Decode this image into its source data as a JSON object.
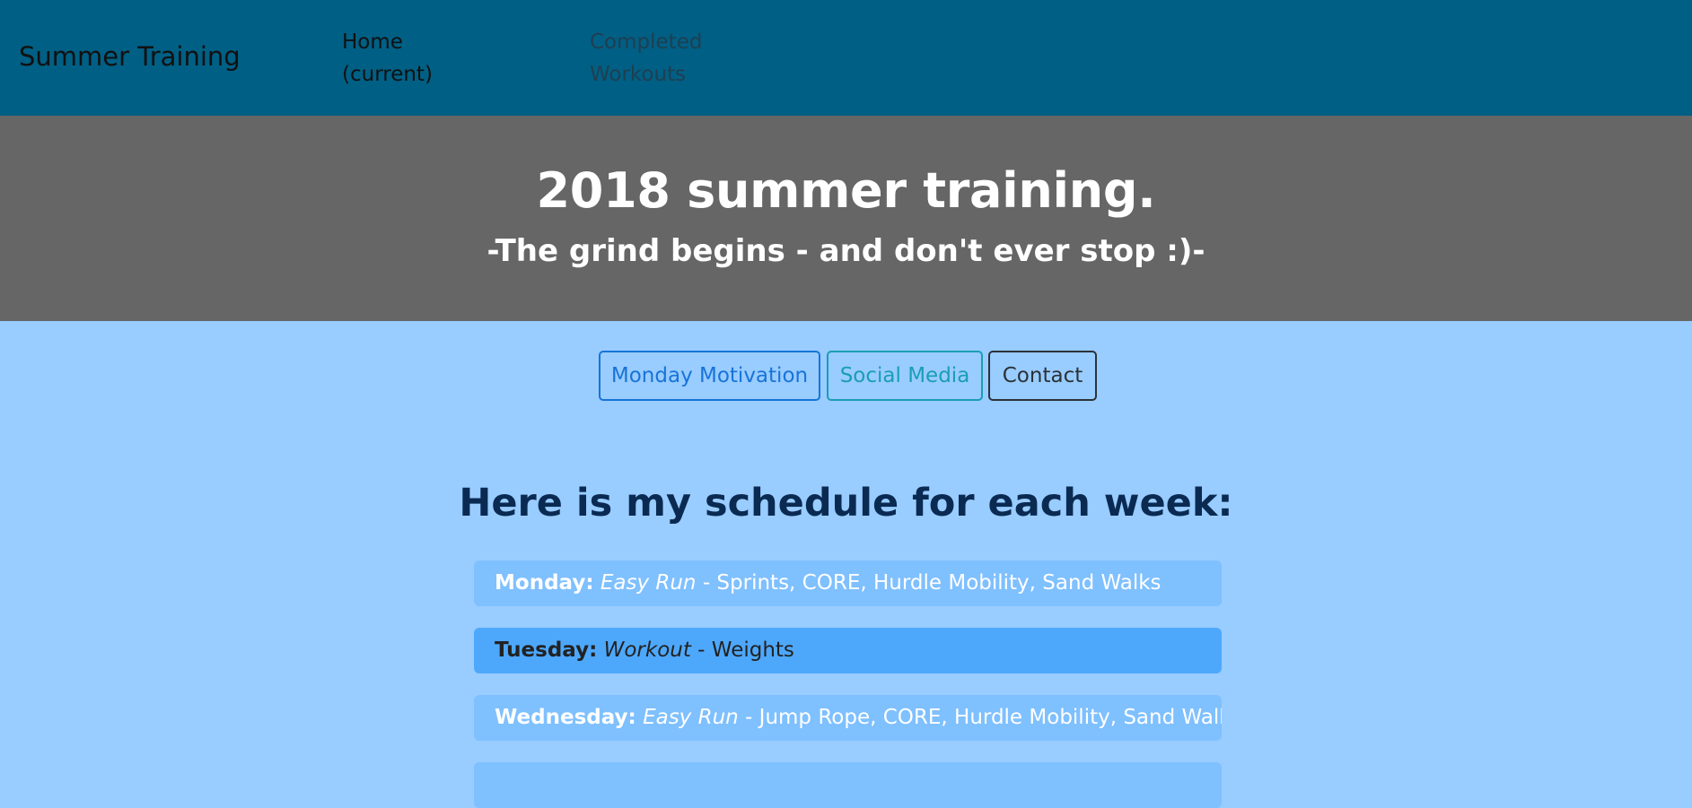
{
  "navbar": {
    "brand": "Summer Training",
    "links": [
      {
        "line1": "Home",
        "line2": "(current)"
      },
      {
        "line1": "Completed",
        "line2": "Workouts"
      }
    ]
  },
  "hero": {
    "title": "2018 summer training.",
    "subtitle": "-The grind begins - and don't ever stop :)-"
  },
  "buttons": {
    "monday": "Monday Motivation",
    "social": "Social Media",
    "contact": "Contact"
  },
  "schedule": {
    "heading": "Here is my schedule for each week:",
    "items": [
      {
        "day": "Monday:",
        "type": "Easy Run",
        "detail": " - Sprints, CORE, Hurdle Mobility, Sand Walks"
      },
      {
        "day": "Tuesday:",
        "type": "Workout",
        "detail": " - Weights"
      },
      {
        "day": "Wednesday:",
        "type": "Easy Run",
        "detail": " - Jump Rope, CORE, Hurdle Mobility, Sand Walks"
      }
    ]
  },
  "colors": {
    "navbar": "#005f84",
    "hero": "#666666",
    "page": "#99ccff",
    "item_light": "#7fc0ff",
    "item_dark": "#4da8fc"
  }
}
